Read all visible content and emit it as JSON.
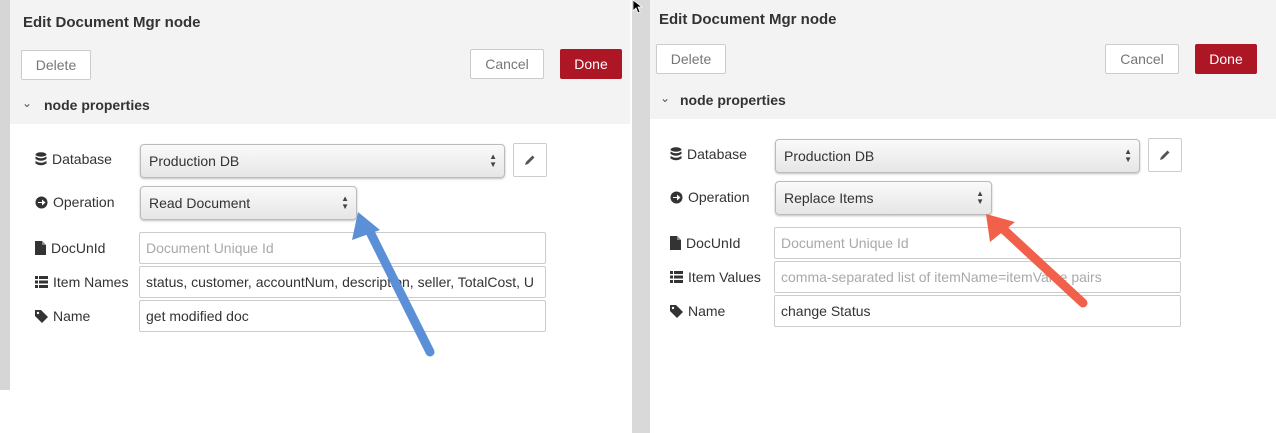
{
  "left_dialog": {
    "title": "Edit Document Mgr node",
    "delete_label": "Delete",
    "cancel_label": "Cancel",
    "done_label": "Done",
    "section_title": "node properties",
    "database_label": "Database",
    "database_value": "Production DB",
    "operation_label": "Operation",
    "operation_value": "Read Document",
    "docunid_label": "DocUnId",
    "docunid_placeholder": "Document Unique Id",
    "items_label": "Item Names",
    "items_value": "status, customer, accountNum, description, seller, TotalCost, U",
    "name_label": "Name",
    "name_value": "get modified doc"
  },
  "right_dialog": {
    "title": "Edit Document Mgr node",
    "delete_label": "Delete",
    "cancel_label": "Cancel",
    "done_label": "Done",
    "section_title": "node properties",
    "database_label": "Database",
    "database_value": "Production DB",
    "operation_label": "Operation",
    "operation_value": "Replace Items",
    "docunid_label": "DocUnId",
    "docunid_placeholder": "Document Unique Id",
    "items_label": "Item Values",
    "items_placeholder": "comma-separated list of itemName=itemValue pairs",
    "name_label": "Name",
    "name_value": "change Status"
  },
  "annotations": {
    "left_arrow_color": "#5b8fd6",
    "right_arrow_color": "#f0604a"
  },
  "colors": {
    "done_button": "#ad1625",
    "header_bg": "#f3f3f3"
  }
}
